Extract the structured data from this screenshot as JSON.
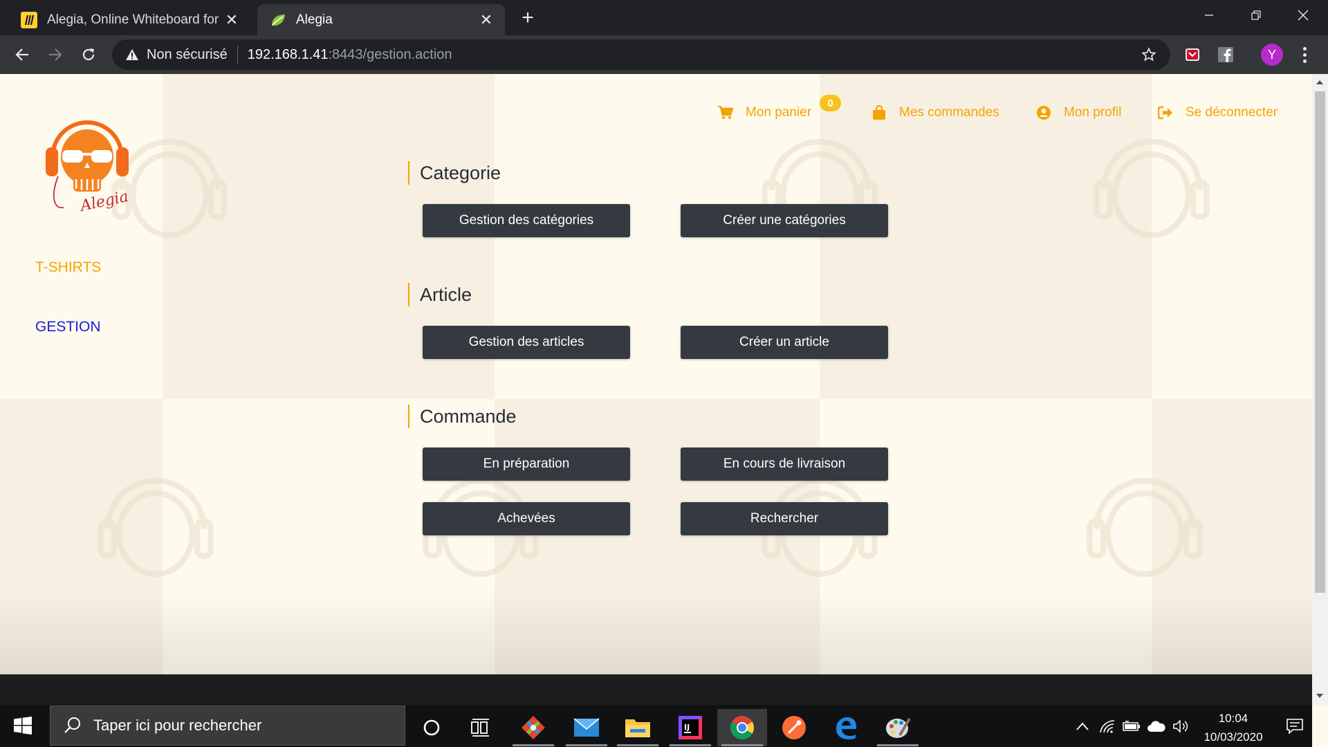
{
  "browser": {
    "tabs": [
      {
        "title": "Alegia, Online Whiteboard for Vis",
        "active": false,
        "favicon": "miro-icon"
      },
      {
        "title": "Alegia",
        "active": true,
        "favicon": "spring-leaf-icon"
      }
    ],
    "new_tab": "+",
    "address": {
      "security_label": "Non sécurisé",
      "host": "192.168.1.41",
      "path": ":8443/gestion.action"
    },
    "profile_initial": "Y"
  },
  "site": {
    "logo_text": "Alegia",
    "sidebar": [
      {
        "label": "T-SHIRTS",
        "color": "#f5a300"
      },
      {
        "label": "GESTION",
        "color": "#1a1adb"
      }
    ],
    "topnav": {
      "cart": "Mon panier",
      "cart_count": "0",
      "orders": "Mes commandes",
      "profile": "Mon profil",
      "logout": "Se déconnecter"
    },
    "accent_color": "#f5a300",
    "button_color": "#343a40"
  },
  "sections": [
    {
      "title": "Categorie",
      "buttons": [
        "Gestion des catégories",
        "Créer une catégories"
      ]
    },
    {
      "title": "Article",
      "buttons": [
        "Gestion des articles",
        "Créer un article"
      ]
    },
    {
      "title": "Commande",
      "buttons": [
        "En préparation",
        "En cours de livraison",
        "Achevées",
        "Rechercher"
      ]
    }
  ],
  "taskbar": {
    "search_placeholder": "Taper ici pour rechercher",
    "time": "10:04",
    "date": "10/03/2020"
  }
}
